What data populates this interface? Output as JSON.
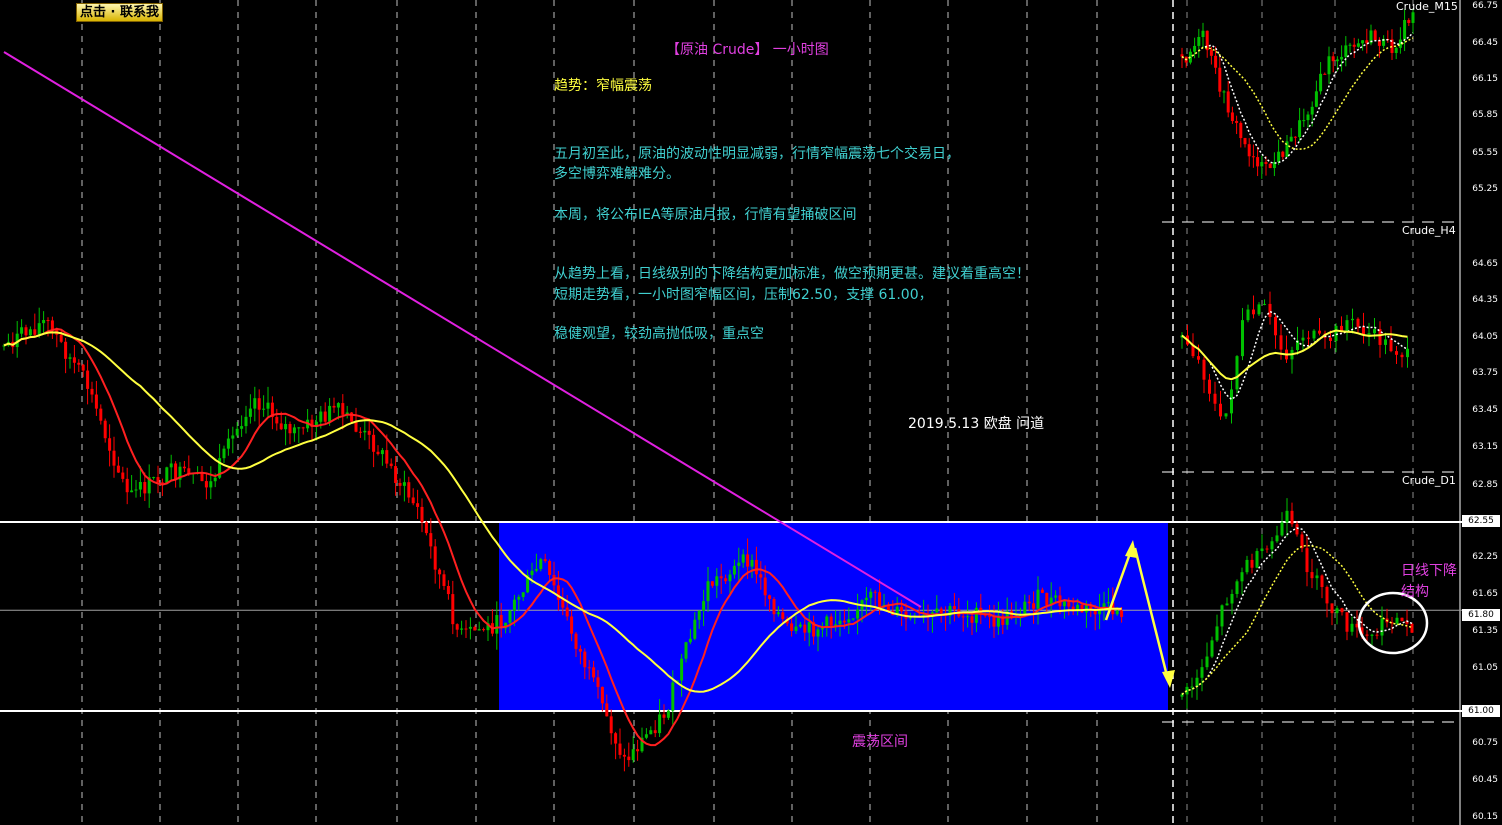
{
  "header": {
    "contact_button": "点击 · 联系我"
  },
  "annotations": {
    "title": "【原油 Crude】  一小时图",
    "trend": "趋势：窄幅震荡",
    "para1_line1": "五月初至此，原油的波动性明显减弱，行情窄幅震荡七个交易日，",
    "para1_line2": "多空博弈难解难分。",
    "para2": "本周，将公布IEA等原油月报，行情有望捅破区间",
    "para3_line1": "从趋势上看，日线级别的下降结构更加标准，做空预期更甚。建议着重高空！",
    "para3_line2": "短期走势看，一小时图窄幅区间，压制62.50，支撑 61.00，",
    "para4": "稳健观望，较劲高抛低吸，重点空",
    "date_note": "2019.5.13  欧盘 问道",
    "range_label": "震荡区间",
    "daily_note_line1": "日线下降",
    "daily_note_line2": "结构"
  },
  "colors": {
    "background": "#000000",
    "bull_candle": "#00c000",
    "bear_candle": "#ff0000",
    "ma_fast": "#ff2020",
    "ma_slow": "#ffff40",
    "trendline": "#e020e0",
    "range_box": "#0000ff",
    "text_cyan": "#40d0d0",
    "text_magenta": "#e040e0",
    "text_yellow": "#ffff40"
  },
  "chart_data": [
    {
      "type": "candlestick",
      "panel": "main",
      "levels": {
        "resistance": 62.5,
        "support": 61.0,
        "current": 61.8
      },
      "x_labels": [],
      "approx_close_path": [
        63.9,
        64.1,
        63.6,
        62.7,
        62.9,
        62.8,
        63.5,
        63.2,
        63.4,
        63.1,
        62.6,
        61.6,
        61.7,
        62.2,
        61.4,
        60.6,
        61.0,
        62.0,
        62.2,
        61.6,
        61.7,
        61.9,
        61.7,
        61.8,
        61.7,
        61.9,
        61.8,
        61.8
      ]
    },
    {
      "type": "candlestick",
      "panel": "Crude_M15",
      "title": "Crude_M15",
      "y_ticks": [
        "66.75",
        "66.45",
        "66.15",
        "65.85",
        "65.55",
        "65.25"
      ],
      "approx_close_path": [
        66.3,
        66.5,
        66.0,
        65.6,
        65.4,
        65.6,
        65.9,
        66.3,
        66.4,
        66.5,
        66.4,
        66.7
      ]
    },
    {
      "type": "candlestick",
      "panel": "Crude_H4",
      "title": "Crude_H4",
      "y_ticks": [
        "64.65",
        "64.35",
        "64.05",
        "63.75",
        "63.45",
        "63.15"
      ],
      "approx_close_path": [
        64.1,
        63.8,
        63.3,
        64.2,
        64.3,
        63.9,
        64.1,
        64.0,
        64.2,
        64.1,
        64.0,
        63.9
      ]
    },
    {
      "type": "candlestick",
      "panel": "Crude_D1",
      "title": "Crude_D1",
      "y_ticks": [
        "62.85",
        "62.55",
        "62.25",
        "61.95",
        "61.65",
        "61.35",
        "61.05",
        "60.75",
        "60.45",
        "60.15"
      ],
      "price_tags": [
        "62.55",
        "61.80",
        "61.00"
      ],
      "approx_close_path": [
        61.1,
        61.4,
        61.9,
        62.2,
        62.3,
        62.6,
        62.2,
        61.9,
        61.7,
        61.6,
        61.8,
        61.7
      ]
    }
  ]
}
